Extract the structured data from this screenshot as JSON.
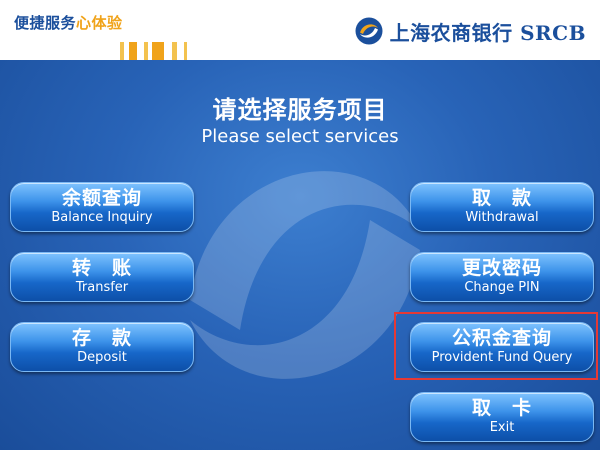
{
  "header": {
    "slogan_part1": "便捷服务",
    "slogan_part2": "心体验",
    "brand_name": "上海农商银行 SRCB"
  },
  "main": {
    "title_cn": "请选择服务项目",
    "title_en": "Please select services"
  },
  "buttons": {
    "balance": {
      "cn": "余额查询",
      "en": "Balance Inquiry"
    },
    "transfer": {
      "cn": "转　账",
      "en": "Transfer"
    },
    "deposit": {
      "cn": "存　款",
      "en": "Deposit"
    },
    "withdrawal": {
      "cn": "取　款",
      "en": "Withdrawal"
    },
    "change_pin": {
      "cn": "更改密码",
      "en": "Change PIN"
    },
    "provident_fund": {
      "cn": "公积金查询",
      "en": "Provident Fund Query"
    },
    "exit": {
      "cn": "取　卡",
      "en": "Exit"
    }
  },
  "colors": {
    "brand_blue": "#1b4f9c",
    "accent_orange": "#f0a31a",
    "button_blue": "#1767c9",
    "highlight_red": "#e53935"
  }
}
